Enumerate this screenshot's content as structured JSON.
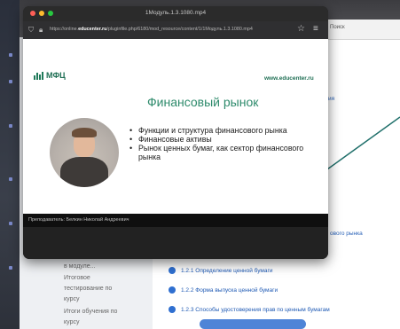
{
  "window": {
    "title": "1Модуль.1.3.1080.mp4",
    "url_prefix": "https://online.",
    "url_domain": "educenter.ru",
    "url_suffix": "/pluginfile.php/6180/mod_resource/content/1/1Модуль.1.3.1080.mp4"
  },
  "slide": {
    "logo": "МФЦ",
    "site": "www.educenter.ru",
    "title": "Финансовый рынок",
    "bullets": [
      "Функции и структура финансового рынка",
      "Финансовые активы",
      "Рынок ценных бумаг, как сектор финансового рынка"
    ],
    "caption": "Преподаватель: Белкин Николай Андреевич"
  },
  "background": {
    "search_label": "Поиск",
    "link_top": "ия",
    "link_right": "ового рынка",
    "sidebar": [
      "в модуле...",
      "Итоговое",
      "тестирование по",
      "курсу",
      "Итоги обучения по",
      "курсу"
    ],
    "items": [
      "1.2.1 Определение ценной бумаги",
      "1.2.2 Форма выпуска ценной бумаги",
      "1.2.3 Способы удостоверения прав по ценным бумагам"
    ]
  },
  "colors": {
    "brand_green": "#2d8a6b",
    "link_blue": "#2f6fd0",
    "connector": "#1f6f6a"
  }
}
